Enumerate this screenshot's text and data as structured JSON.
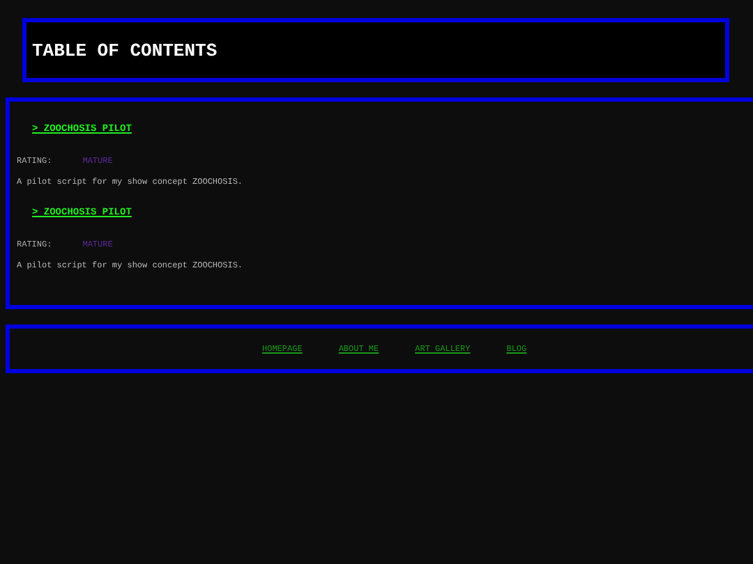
{
  "header": {
    "title": "TABLE OF CONTENTS"
  },
  "entries": [
    {
      "title": "> ZOOCHOSIS PILOT",
      "rating_label": "RATING:",
      "rating": "MATURE",
      "description": "A pilot script for my show concept ZOOCHOSIS."
    },
    {
      "title": "> ZOOCHOSIS PILOT",
      "rating_label": "RATING:",
      "rating": "MATURE",
      "description": "A pilot script for my show concept ZOOCHOSIS."
    }
  ],
  "nav": [
    "HOMEPAGE",
    "ABOUT ME",
    "ART GALLERY",
    "BLOG"
  ]
}
